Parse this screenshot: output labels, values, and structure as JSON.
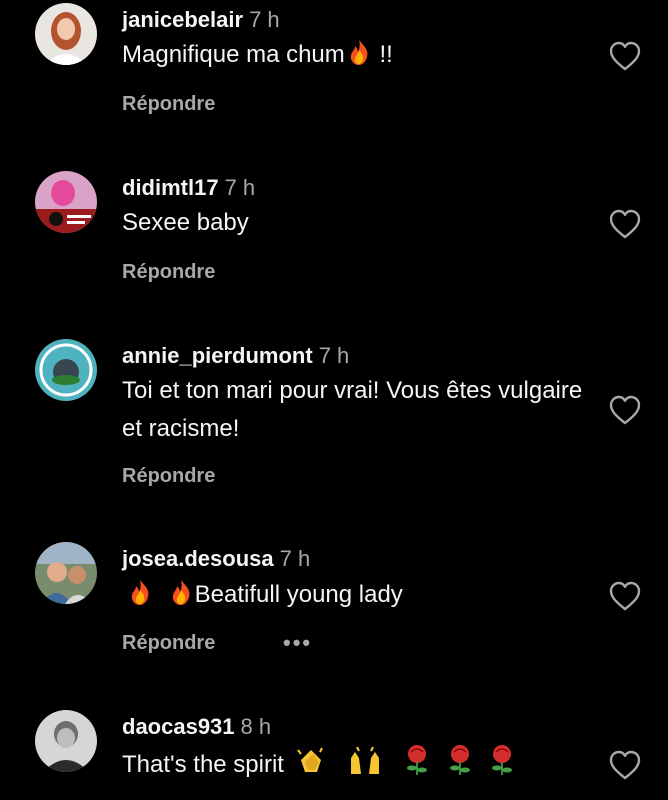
{
  "comments": [
    {
      "username": "janicebelair",
      "time": "7 h",
      "text": "Magnifique ma chum",
      "text_after": " !!",
      "reply_label": "Répondre",
      "emojis": [
        "fire"
      ]
    },
    {
      "username": "didimtl17",
      "time": "7 h",
      "text": "Sexee baby",
      "reply_label": "Répondre"
    },
    {
      "username": "annie_pierdumont",
      "time": "7 h",
      "text": "Toi et ton mari pour vrai! Vous êtes vulgaire et racisme!",
      "reply_label": "Répondre"
    },
    {
      "username": "josea.desousa",
      "time": "7 h",
      "text": "Beatifull young lady",
      "reply_label": "Répondre",
      "more_label": "•••",
      "emojis": [
        "fire",
        "fire"
      ]
    },
    {
      "username": "daocas931",
      "time": "8 h",
      "text": "That's the spirit",
      "emojis": [
        "clapping-hands",
        "raising-hands",
        "rose",
        "rose",
        "rose"
      ]
    }
  ],
  "icons": {
    "like": "heart-outline-icon",
    "more": "more-options-icon"
  },
  "colors": {
    "background": "#000000",
    "primary_text": "#f5f5f5",
    "secondary_text": "#a8a8a8"
  }
}
